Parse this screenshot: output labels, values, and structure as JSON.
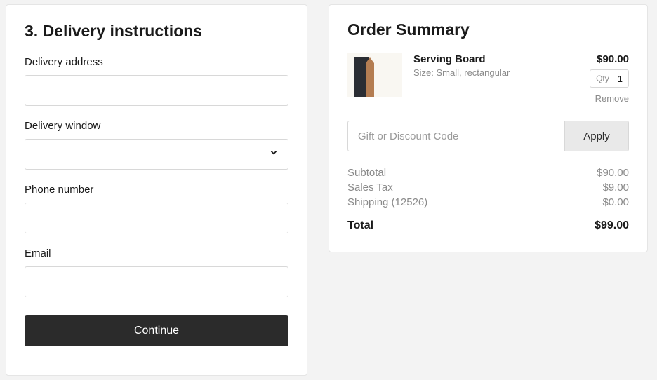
{
  "delivery": {
    "section_title": "3.  Delivery instructions",
    "address_label": "Delivery address",
    "address_value": "",
    "window_label": "Delivery window",
    "window_value": "",
    "phone_label": "Phone number",
    "phone_value": "",
    "email_label": "Email",
    "email_value": "",
    "continue_label": "Continue"
  },
  "summary": {
    "title": "Order Summary",
    "item": {
      "name": "Serving Board",
      "variant": "Size: Small, rectangular",
      "price": "$90.00",
      "qty_label": "Qty",
      "qty_value": "1",
      "remove_label": "Remove"
    },
    "promo": {
      "placeholder": "Gift or Discount Code",
      "apply_label": "Apply"
    },
    "totals": {
      "subtotal_label": "Subtotal",
      "subtotal_value": "$90.00",
      "tax_label": "Sales Tax",
      "tax_value": "$9.00",
      "shipping_label": "Shipping (12526)",
      "shipping_value": "$0.00",
      "total_label": "Total",
      "total_value": "$99.00"
    }
  }
}
